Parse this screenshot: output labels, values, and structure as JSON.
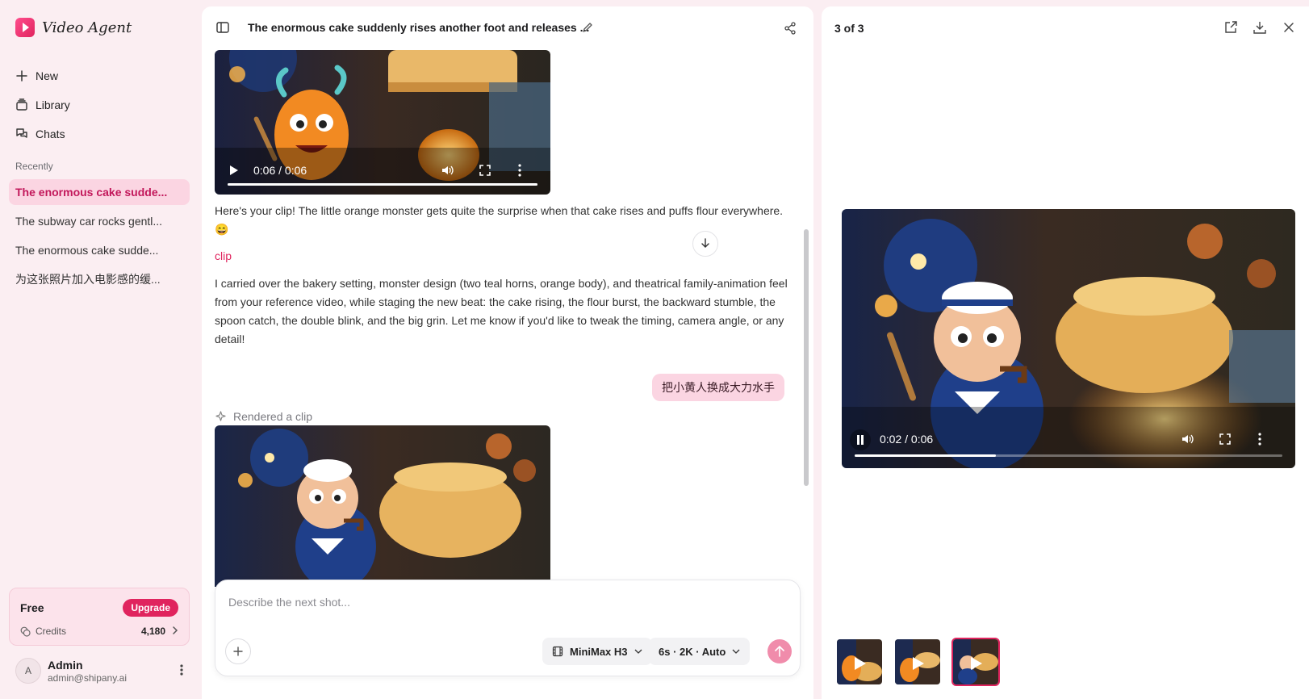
{
  "app": {
    "name": "Video Agent"
  },
  "nav": {
    "items": [
      {
        "label": "New",
        "icon": "plus-icon"
      },
      {
        "label": "Library",
        "icon": "library-icon"
      },
      {
        "label": "Chats",
        "icon": "chats-icon"
      }
    ]
  },
  "recent": {
    "heading": "Recently",
    "items": [
      {
        "label": "The enormous cake sudde..."
      },
      {
        "label": "The subway car rocks gentl..."
      },
      {
        "label": "The enormous cake sudde..."
      },
      {
        "label": "为这张照片加入电影感的缓..."
      }
    ]
  },
  "plan": {
    "name": "Free",
    "upgrade_label": "Upgrade",
    "credits_label": "Credits",
    "credits_value": "4,180"
  },
  "user": {
    "initial": "A",
    "name": "Admin",
    "email": "admin@shipany.ai"
  },
  "chat": {
    "title": "The enormous cake suddenly rises another foot and releases ...",
    "video1": {
      "time": "0:06 / 0:06",
      "progress": 1.0
    },
    "assistant_message": "Here's your clip! The little orange monster gets quite the surprise when that cake rises and puffs flour everywhere. 😄",
    "clip_link": "clip",
    "detail_message": "I carried over the bakery setting, monster design (two teal horns, orange body), and theatrical family-animation feel from your reference video, while staging the new beat: the cake rising, the flour burst, the backward stumble, the spoon catch, the double blink, and the big grin. Let me know if you'd like to tweak the timing, camera angle, or any detail!",
    "user_message": "把小黄人换成大力水手",
    "rendered_label": "Rendered a clip"
  },
  "composer": {
    "placeholder": "Describe the next shot...",
    "model_label": "MiniMax H3",
    "settings_label": "6s · 2K · Auto"
  },
  "preview": {
    "counter": "3 of 3",
    "video": {
      "time": "0:02 / 0:06",
      "progress": 0.33
    },
    "thumbnails": 3,
    "active_thumbnail": 3
  },
  "colors": {
    "accent": "#e0245e",
    "sidebar_bg": "#fbeef2",
    "active_item_bg": "#fbd5e2"
  }
}
